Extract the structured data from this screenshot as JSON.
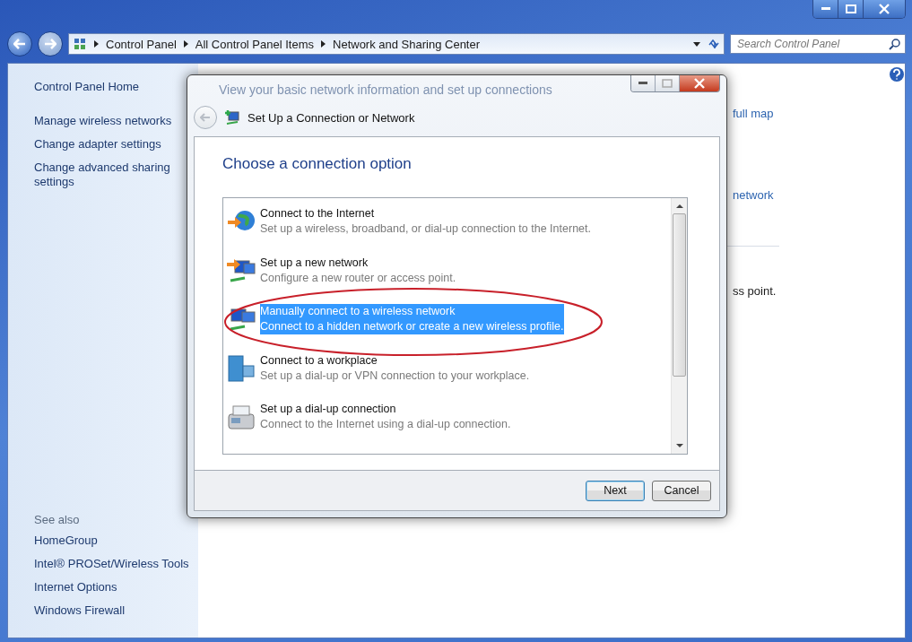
{
  "address_bar": {
    "breadcrumbs": [
      "Control Panel",
      "All Control Panel Items",
      "Network and Sharing Center"
    ]
  },
  "search": {
    "placeholder": "Search Control Panel"
  },
  "sidebar": {
    "home": "Control Panel Home",
    "links": [
      "Manage wireless networks",
      "Change adapter settings",
      "Change advanced sharing settings"
    ],
    "see_also_title": "See also",
    "see_also": [
      "HomeGroup",
      "Intel® PROSet/Wireless Tools",
      "Internet Options",
      "Windows Firewall"
    ]
  },
  "main": {
    "fragments": [
      {
        "kind": "link",
        "text": "full map"
      },
      {
        "kind": "link",
        "text": "network"
      },
      {
        "kind": "rule"
      },
      {
        "kind": "text",
        "text": "ss point."
      }
    ]
  },
  "dialog": {
    "behind_heading": "View your basic network information and set up connections",
    "title": "Set Up a Connection or Network",
    "heading": "Choose a connection option",
    "options": [
      {
        "kind": "internet",
        "title": "Connect to the Internet",
        "description": "Set up a wireless, broadband, or dial-up connection to the Internet.",
        "selected": false
      },
      {
        "kind": "new-network",
        "title": "Set up a new network",
        "description": "Configure a new router or access point.",
        "selected": false
      },
      {
        "kind": "wireless",
        "title": "Manually connect to a wireless network",
        "description": "Connect to a hidden network or create a new wireless profile.",
        "selected": true
      },
      {
        "kind": "workplace",
        "title": "Connect to a workplace",
        "description": "Set up a dial-up or VPN connection to your workplace.",
        "selected": false
      },
      {
        "kind": "dialup",
        "title": "Set up a dial-up connection",
        "description": "Connect to the Internet using a dial-up connection.",
        "selected": false
      }
    ],
    "buttons": [
      {
        "label": "Next",
        "default": true
      },
      {
        "label": "Cancel",
        "default": false
      }
    ]
  }
}
